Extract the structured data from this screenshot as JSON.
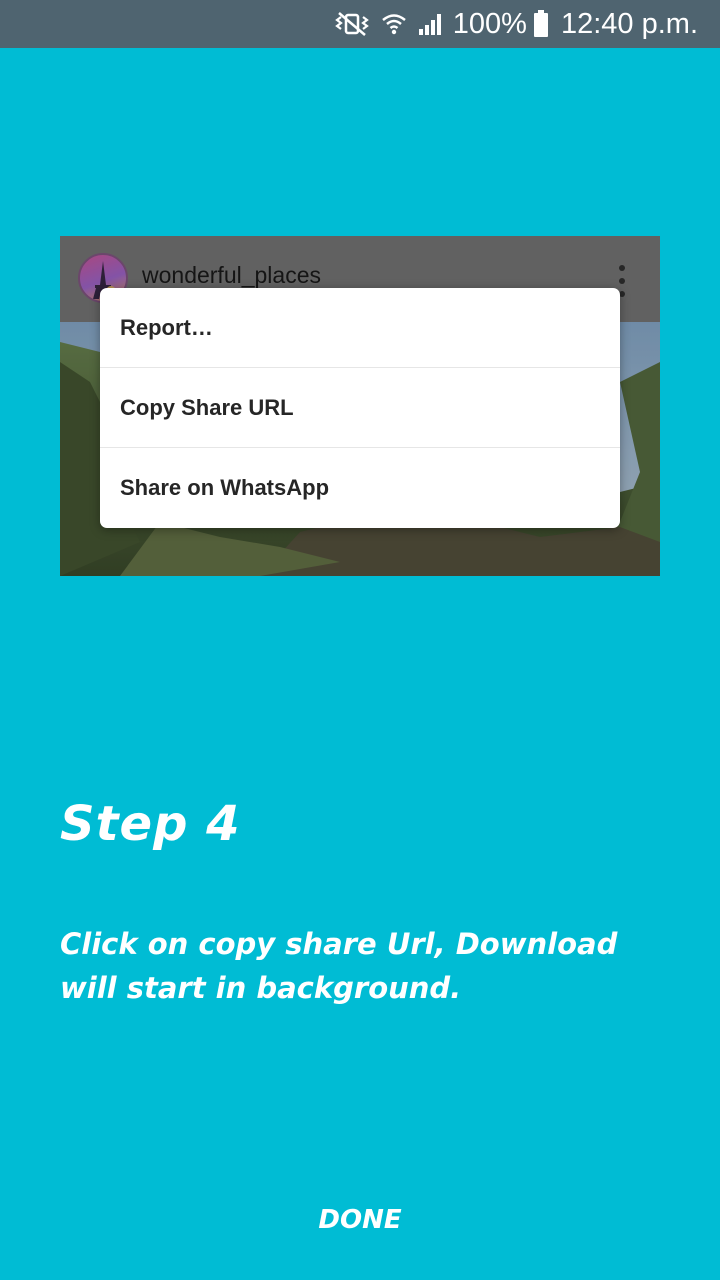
{
  "status_bar": {
    "icons": [
      "mute-vibrate-icon",
      "wifi-icon",
      "signal-icon",
      "battery-icon"
    ],
    "battery_percent": "100%",
    "time": "12:40 p.m.",
    "background": "#4f6470"
  },
  "preview": {
    "username": "wonderful_places",
    "menu_items": [
      "Report…",
      "Copy Share URL",
      "Share on WhatsApp"
    ]
  },
  "step": {
    "title": "Step 4",
    "description": "Click on copy share Url, Download will start in background."
  },
  "actions": {
    "done_label": "DONE"
  },
  "colors": {
    "background": "#00bcd4",
    "text": "#ffffff"
  }
}
